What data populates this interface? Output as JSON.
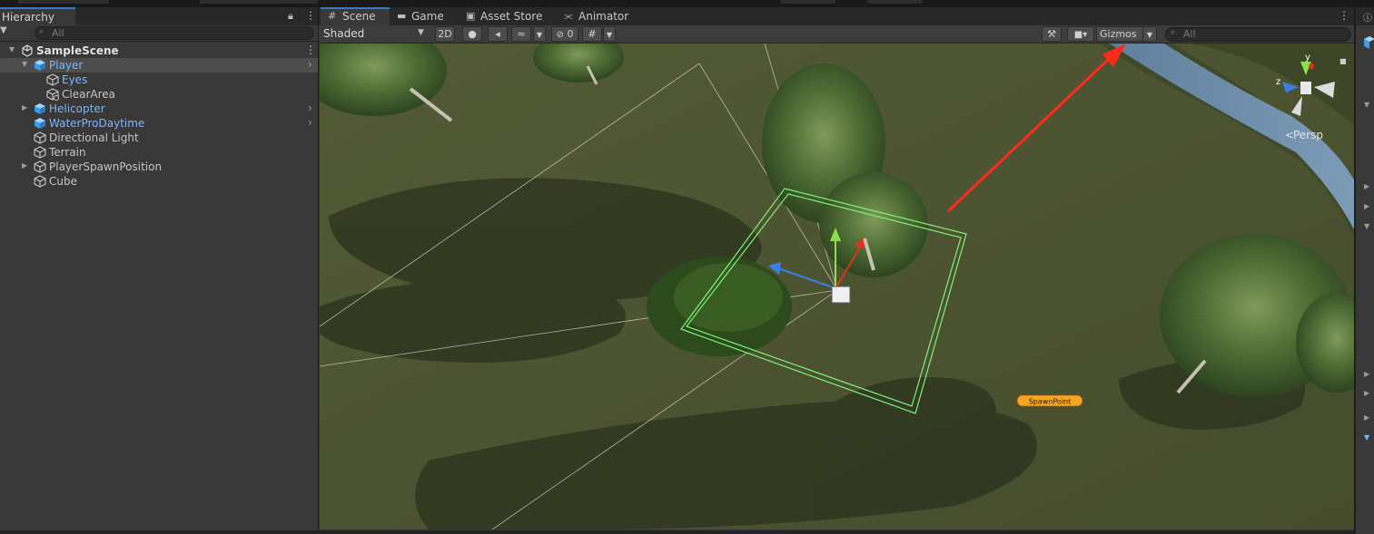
{
  "hierarchy": {
    "title": "Hierarchy",
    "search_placeholder": "All",
    "scene_name": "SampleScene",
    "items": [
      {
        "label": "Player",
        "icon": "prefab-cube-icon"
      },
      {
        "label": "Eyes",
        "icon": "gameobject-cube-icon"
      },
      {
        "label": "ClearArea",
        "icon": "gameobject-cube-icon"
      },
      {
        "label": "Helicopter",
        "icon": "prefab-cube-icon"
      },
      {
        "label": "WaterProDaytime",
        "icon": "prefab-cube-icon"
      },
      {
        "label": "Directional Light",
        "icon": "gameobject-cube-icon"
      },
      {
        "label": "Terrain",
        "icon": "gameobject-cube-icon"
      },
      {
        "label": "PlayerSpawnPosition",
        "icon": "gameobject-cube-icon"
      },
      {
        "label": "Cube",
        "icon": "gameobject-cube-icon"
      }
    ]
  },
  "scene_view": {
    "tabs": [
      {
        "label": "Scene",
        "icon": "grid-icon"
      },
      {
        "label": "Game",
        "icon": "gamepad-icon"
      },
      {
        "label": "Asset Store",
        "icon": "bag-icon"
      },
      {
        "label": "Animator",
        "icon": "animator-icon"
      }
    ],
    "toolbar": {
      "draw_mode": "Shaded",
      "mode_2d": "2D",
      "hidden_count": "0",
      "gizmos": "Gizmos",
      "search_placeholder": "All"
    },
    "orientation_gizmo": {
      "axis_y": "y",
      "axis_z": "z",
      "projection": "Persp"
    },
    "spawn_label": "SpawnPoint"
  },
  "colors": {
    "accent": "#3a79bb",
    "prefab_text": "#7ab7ff",
    "selection_box": "#7df27a",
    "annotation_arrow": "#ff2a1a",
    "spawn_badge": "#f5a623"
  }
}
